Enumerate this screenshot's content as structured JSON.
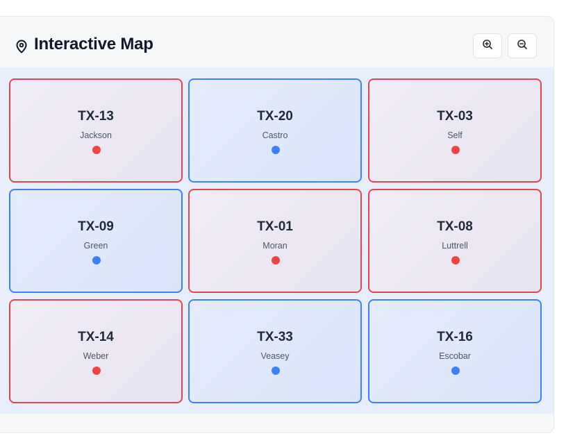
{
  "header": {
    "title": "Interactive Map",
    "icon": "map-pin-icon",
    "zoom_in_icon": "zoom-in-icon",
    "zoom_out_icon": "zoom-out-icon"
  },
  "colors": {
    "red_party": "#ef4444",
    "blue_party": "#3b82f6",
    "map_background": "#e8eefc"
  },
  "districts": [
    {
      "code": "TX-13",
      "name": "Jackson",
      "party": "red"
    },
    {
      "code": "TX-20",
      "name": "Castro",
      "party": "blue"
    },
    {
      "code": "TX-03",
      "name": "Self",
      "party": "red"
    },
    {
      "code": "TX-09",
      "name": "Green",
      "party": "blue"
    },
    {
      "code": "TX-01",
      "name": "Moran",
      "party": "red"
    },
    {
      "code": "TX-08",
      "name": "Luttrell",
      "party": "red"
    },
    {
      "code": "TX-14",
      "name": "Weber",
      "party": "red"
    },
    {
      "code": "TX-33",
      "name": "Veasey",
      "party": "blue"
    },
    {
      "code": "TX-16",
      "name": "Escobar",
      "party": "blue"
    }
  ]
}
